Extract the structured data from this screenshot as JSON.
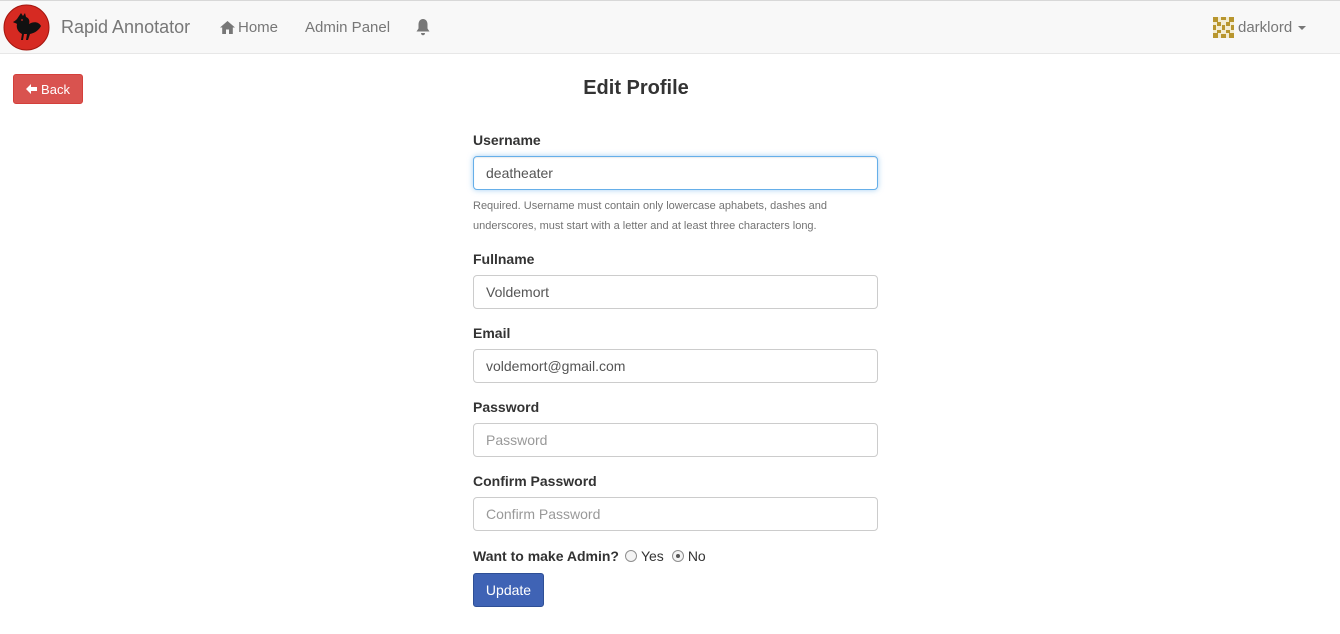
{
  "navbar": {
    "brand": "Rapid Annotator",
    "home_label": "Home",
    "admin_label": "Admin Panel",
    "bell_icon": "bell-icon",
    "username": "darklord"
  },
  "page": {
    "back_label": "Back",
    "title": "Edit Profile"
  },
  "form": {
    "username": {
      "label": "Username",
      "value": "deatheater",
      "help": "Required. Username must contain only lowercase aphabets, dashes and underscores, must start with a letter and at least three characters long."
    },
    "fullname": {
      "label": "Fullname",
      "value": "Voldemort"
    },
    "email": {
      "label": "Email",
      "value": "voldemort@gmail.com"
    },
    "password": {
      "label": "Password",
      "placeholder": "Password"
    },
    "confirm_password": {
      "label": "Confirm Password",
      "placeholder": "Confirm Password"
    },
    "admin": {
      "label": "Want to make Admin?",
      "yes": "Yes",
      "no": "No",
      "selected": "No"
    },
    "submit_label": "Update"
  },
  "colors": {
    "danger": "#d9534f",
    "primary": "#3f63b5",
    "focus": "#66afe9"
  }
}
